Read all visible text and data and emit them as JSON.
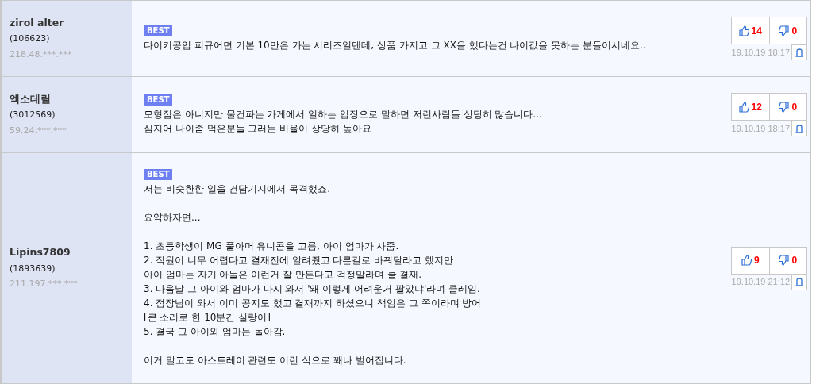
{
  "comments": [
    {
      "user": "zirol alter",
      "user_id": "(106623)",
      "ip": "218.48.***.***",
      "badge": "BEST",
      "paragraphs": [
        [
          "다이키공업 피규어면 기본 10만은 가는 시리즈일텐데, 상품 가지고 그 XX을 했다는건 나이값을 못하는 분들이시네요.."
        ]
      ],
      "likes": "14",
      "dislikes": "0",
      "date": "19.10.19 18:17"
    },
    {
      "user": "엑소데릴",
      "user_id": "(3012569)",
      "ip": "59.24.***.***",
      "badge": "BEST",
      "paragraphs": [
        [
          "모형점은 아니지만 물건파는 가게에서 일하는 입장으로 말하면 저런사람들 상당히 많습니다...",
          "심지어 나이좀 먹은분들 그러는 비율이 상당히 높아요"
        ]
      ],
      "likes": "12",
      "dislikes": "0",
      "date": "19.10.19 18:17"
    },
    {
      "user": "Lipins7809",
      "user_id": "(1893639)",
      "ip": "211.197.***.***",
      "badge": "BEST",
      "paragraphs": [
        [
          "저는 비슷한한 일을 건담기지에서 목격했죠."
        ],
        [
          "요약하자면..."
        ],
        [
          "1. 초등학생이 MG 풀아머 유니콘을 고름, 아이 엄마가 사줌.",
          "2. 직원이 너무 어렵다고 결재전에 알려줬고 다른걸로 바꿔달라고 했지만",
          "아이 엄마는 자기 아들은 이런거 잘 만든다고 걱정말라며 쿨 결재.",
          "3. 다음날 그 아이와 엄마가 다시 와서 '왜 이렇게 어려운거 팔았냐'라며 클레임.",
          "4. 점장님이 와서 이미 공지도 했고 결재까지 하셨으니 책임은 그 쪽이라며 방어",
          "[큰 소리로 한 10분간 실랑이]",
          "5. 결국 그 아이와 엄마는 돌아감."
        ],
        [
          "이거 말고도 아스트레이 관련도 이런 식으로 꽤나 벌어집니다."
        ]
      ],
      "likes": "9",
      "dislikes": "0",
      "date": "19.10.19 21:12"
    }
  ]
}
